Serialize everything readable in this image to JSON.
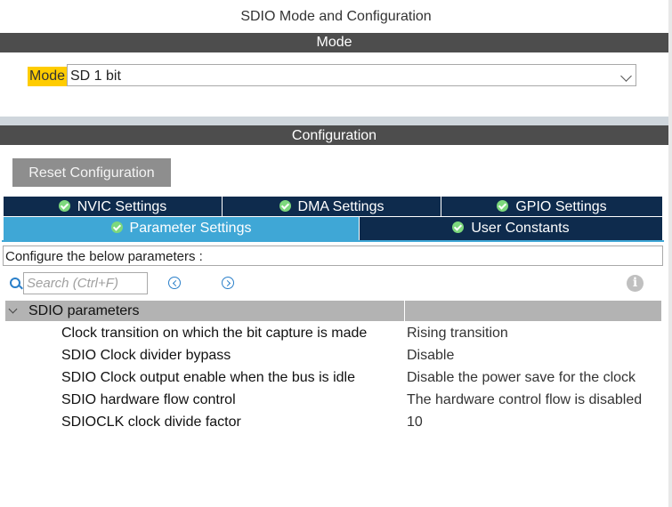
{
  "window": {
    "title": "SDIO Mode and Configuration"
  },
  "mode_section": {
    "header": "Mode",
    "mode_label": "Mode",
    "mode_value": "SD 1 bit"
  },
  "config_section": {
    "header": "Configuration",
    "reset_label": "Reset Configuration",
    "tabs_row1": [
      {
        "label": "NVIC Settings"
      },
      {
        "label": "DMA Settings"
      },
      {
        "label": "GPIO Settings"
      }
    ],
    "tabs_row2": [
      {
        "label": "Parameter Settings",
        "active": true
      },
      {
        "label": "User Constants"
      }
    ],
    "hint": "Configure the below parameters :",
    "search_placeholder": "Search (Ctrl+F)",
    "group": {
      "label": "SDIO parameters",
      "params": [
        {
          "name": "Clock transition on which the bit capture is made",
          "value": "Rising transition"
        },
        {
          "name": "SDIO Clock divider bypass",
          "value": "Disable"
        },
        {
          "name": "SDIO Clock output enable when the bus is idle",
          "value": "Disable the power save for the clock"
        },
        {
          "name": "SDIO hardware flow control",
          "value": "The hardware control flow is disabled"
        },
        {
          "name": "SDIOCLK clock divide factor",
          "value": "10"
        }
      ]
    }
  },
  "colors": {
    "section_bar": "#4d4d4d",
    "tab_dark": "#0e2b4d",
    "tab_active": "#3fa7d6",
    "mode_highlight": "#ffcc00",
    "check_green": "#7dd87d"
  }
}
